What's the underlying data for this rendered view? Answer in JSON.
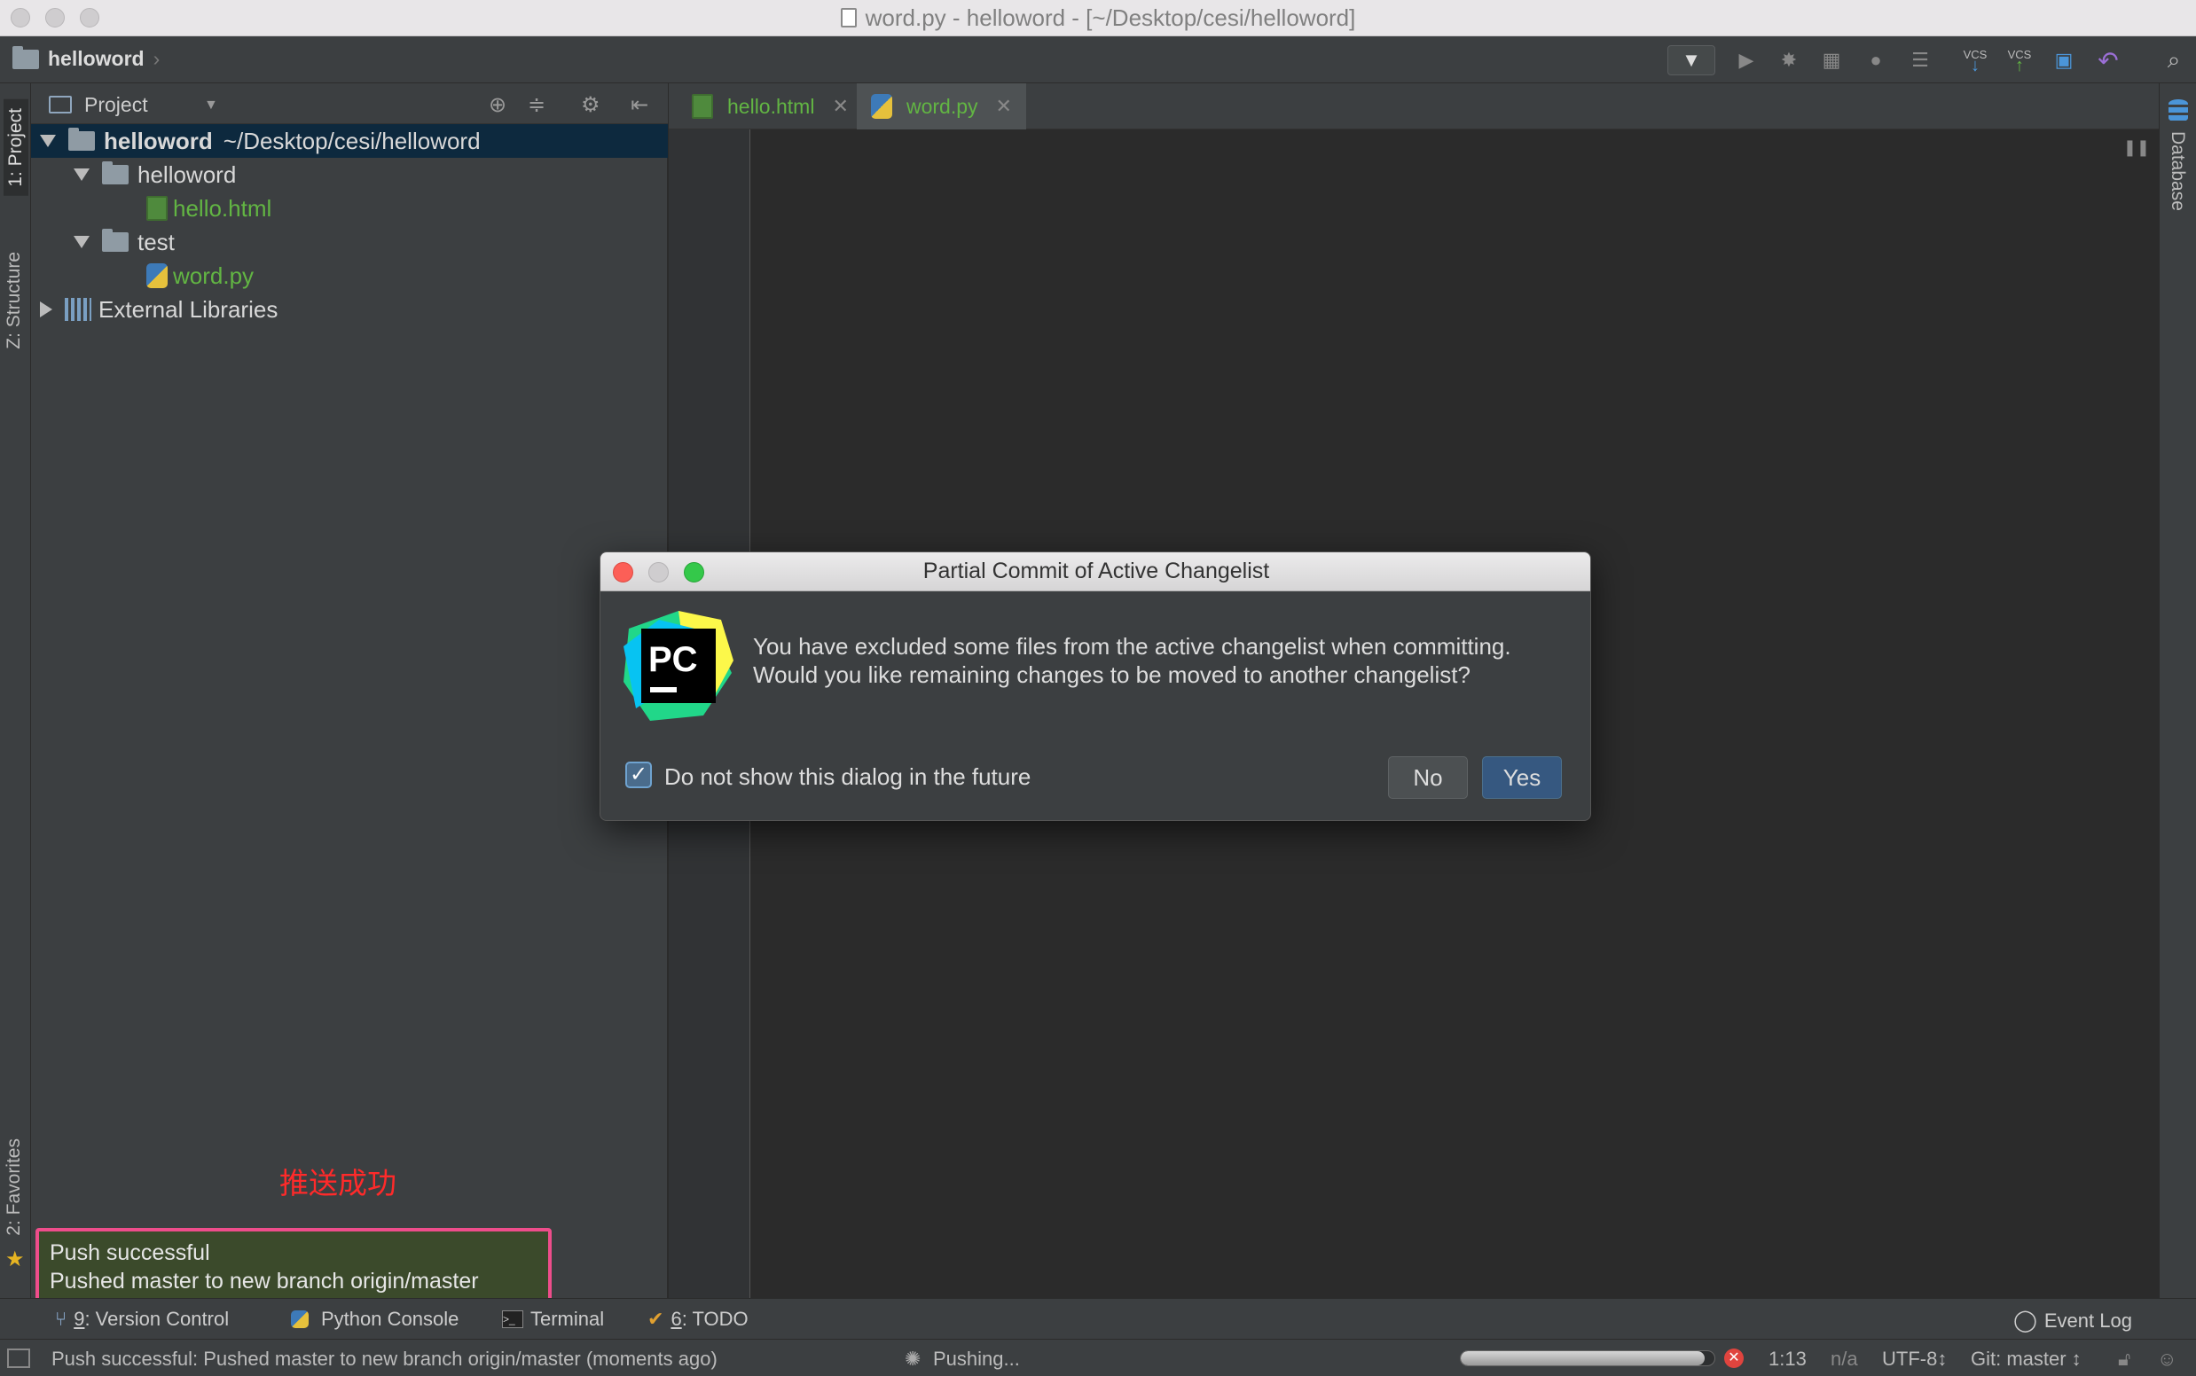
{
  "window": {
    "title": "word.py - helloword - [~/Desktop/cesi/helloword]"
  },
  "navbar": {
    "breadcrumb": "helloword"
  },
  "toolbar": {
    "vcs_label": "VCS"
  },
  "left_tabs": {
    "project": "1: Project",
    "structure": "Z: Structure",
    "favorites": "2: Favorites"
  },
  "project_panel": {
    "header": "Project",
    "tree": [
      {
        "name": "helloword",
        "path": "~/Desktop/cesi/helloword"
      },
      {
        "name": "helloword"
      },
      {
        "name": "hello.html"
      },
      {
        "name": "test"
      },
      {
        "name": "word.py"
      },
      {
        "name": "External Libraries"
      }
    ]
  },
  "editor": {
    "tabs": [
      {
        "label": "hello.html",
        "color": "#62b543"
      },
      {
        "label": "word.py",
        "color": "#62b543"
      }
    ]
  },
  "right_tabs": {
    "database": "Database"
  },
  "annotation": "推送成功",
  "notification": {
    "title": "Push successful",
    "body": "Pushed master to new branch origin/master"
  },
  "dialog": {
    "title": "Partial Commit of Active Changelist",
    "logo_text": "PC",
    "message_line1": "You have excluded some files from the active changelist when committing.",
    "message_line2": "Would you like remaining changes to be moved to another changelist?",
    "checkbox_label": "Do not show this dialog in the future",
    "checkbox_checked": true,
    "no_label": "No",
    "yes_label": "Yes"
  },
  "bottom_tools": {
    "version_control_num": "9",
    "version_control": ": Version Control",
    "python_console": "Python Console",
    "terminal": "Terminal",
    "todo_num": "6",
    "todo": ": TODO",
    "event_log": "Event Log"
  },
  "status": {
    "message": "Push successful: Pushed master to new branch origin/master (moments ago)",
    "task": "Pushing...",
    "progress": 0.96,
    "position": "1:13",
    "na": "n/a",
    "encoding": "UTF-8↕",
    "git": "Git: master ↕"
  }
}
